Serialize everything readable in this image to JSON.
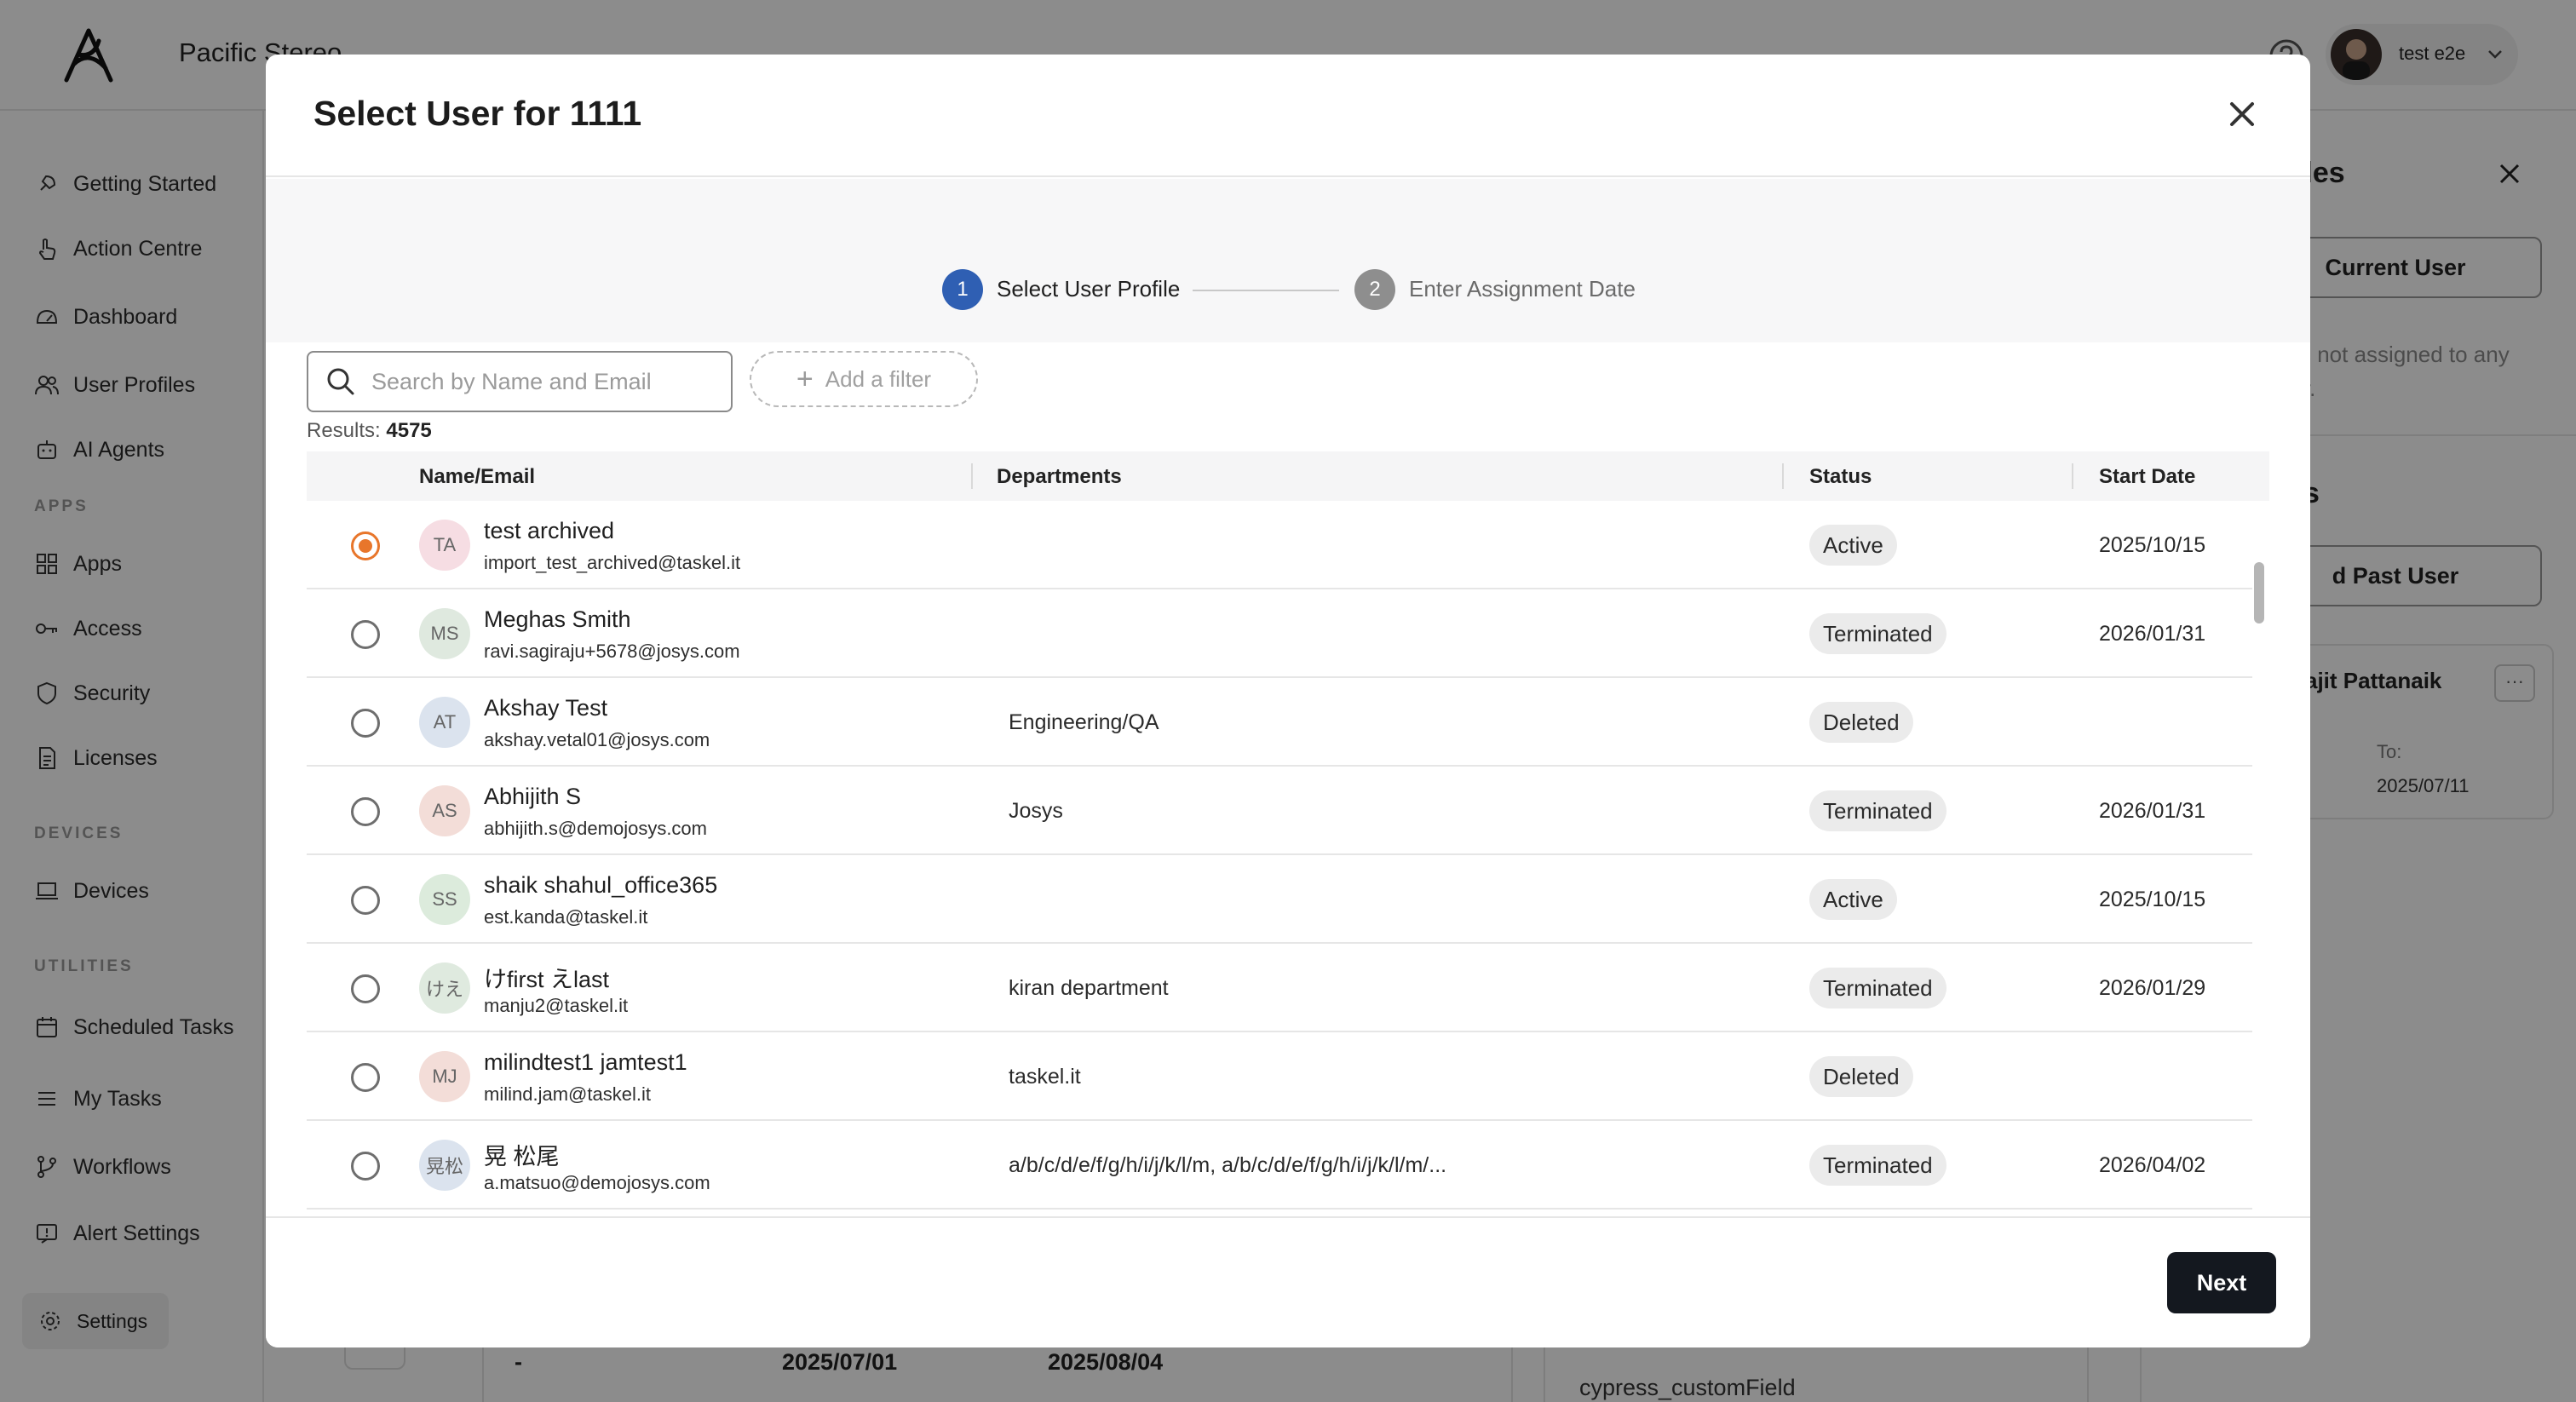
{
  "header": {
    "org_name": "Pacific Stereo",
    "user_name": "test e2e"
  },
  "sidebar": {
    "items": [
      {
        "label": "Getting Started",
        "icon": "rocket-icon"
      },
      {
        "label": "Action Centre",
        "icon": "hand-pointer-icon"
      },
      {
        "label": "Dashboard",
        "icon": "gauge-icon"
      },
      {
        "label": "User Profiles",
        "icon": "users-icon"
      },
      {
        "label": "AI Agents",
        "icon": "robot-icon"
      }
    ],
    "apps_section": "APPS",
    "apps_items": [
      {
        "label": "Apps",
        "icon": "grid-icon"
      },
      {
        "label": "Access",
        "icon": "key-icon"
      },
      {
        "label": "Security",
        "icon": "shield-icon"
      },
      {
        "label": "Licenses",
        "icon": "document-icon"
      }
    ],
    "devices_section": "DEVICES",
    "devices_items": [
      {
        "label": "Devices",
        "icon": "laptop-icon"
      }
    ],
    "utilities_section": "UTILITIES",
    "utilities_items": [
      {
        "label": "Scheduled Tasks",
        "icon": "calendar-icon"
      },
      {
        "label": "My Tasks",
        "icon": "list-icon"
      },
      {
        "label": "Workflows",
        "icon": "branch-icon"
      },
      {
        "label": "Alert Settings",
        "icon": "alert-icon"
      }
    ],
    "settings_label": "Settings"
  },
  "background": {
    "row_dash": "-",
    "row_date_1": "2025/07/01",
    "row_date_2": "2025/08/04",
    "custom_field": "cypress_customField",
    "panel_title_fragment": "iles",
    "current_user_btn": "Current User",
    "not_assigned_line1": "s not assigned to any",
    "not_assigned_line2": "y.",
    "section2_fragment": "s",
    "past_user_btn": "d Past User",
    "card_name": "ajit Pattanaik",
    "card_more": "···",
    "card_to_label": "To:",
    "card_to_date": "2025/07/11"
  },
  "modal": {
    "title": "Select User for 1111",
    "steps": [
      {
        "number": "1",
        "label": "Select User Profile"
      },
      {
        "number": "2",
        "label": "Enter Assignment Date"
      }
    ],
    "search": {
      "placeholder": "Search by Name and Email",
      "value": ""
    },
    "filter_label": "Add a filter",
    "results_label": "Results:",
    "results_count": "4575",
    "columns": [
      "Name/Email",
      "Departments",
      "Status",
      "Start Date"
    ],
    "rows": [
      {
        "initials": "TA",
        "name": "test archived",
        "email": "import_test_archived@taskel.it",
        "department": "",
        "status": "Active",
        "start_date": "2025/10/15",
        "selected": true,
        "avatar_color": "#f6dde3"
      },
      {
        "initials": "MS",
        "name": "Meghas Smith",
        "email": "ravi.sagiraju+5678@josys.com",
        "department": "",
        "status": "Terminated",
        "start_date": "2026/01/31",
        "selected": false,
        "avatar_color": "#dfe9df"
      },
      {
        "initials": "AT",
        "name": "Akshay Test",
        "email": "akshay.vetal01@josys.com",
        "department": "Engineering/QA",
        "status": "Deleted",
        "start_date": "",
        "selected": false,
        "avatar_color": "#dbe3ee"
      },
      {
        "initials": "AS",
        "name": "Abhijith S",
        "email": "abhijith.s@demojosys.com",
        "department": "Josys",
        "status": "Terminated",
        "start_date": "2026/01/31",
        "selected": false,
        "avatar_color": "#f3ddd8"
      },
      {
        "initials": "SS",
        "name": "shaik shahul_office365",
        "email": "est.kanda@taskel.it",
        "department": "",
        "status": "Active",
        "start_date": "2025/10/15",
        "selected": false,
        "avatar_color": "#dcebdc"
      },
      {
        "initials": "けえ",
        "name": "けfirst えlast",
        "email": "manju2@taskel.it",
        "department": "kiran department",
        "status": "Terminated",
        "start_date": "2026/01/29",
        "selected": false,
        "avatar_color": "#dfeadf"
      },
      {
        "initials": "MJ",
        "name": "milindtest1 jamtest1",
        "email": "milind.jam@taskel.it",
        "department": "taskel.it",
        "status": "Deleted",
        "start_date": "",
        "selected": false,
        "avatar_color": "#f3ddd8"
      },
      {
        "initials": "晃松",
        "name": "晃 松尾",
        "email": "a.matsuo@demojosys.com",
        "department": "a/b/c/d/e/f/g/h/i/j/k/l/m, a/b/c/d/e/f/g/h/i/j/k/l/m/...",
        "status": "Terminated",
        "start_date": "2026/04/02",
        "selected": false,
        "avatar_color": "#dbe3ee"
      }
    ],
    "next_label": "Next"
  },
  "colors": {
    "accent_orange": "#e8762b",
    "step_active": "#2f5fb3",
    "step_inactive": "#8e8e8e",
    "primary_button": "#14181f"
  }
}
